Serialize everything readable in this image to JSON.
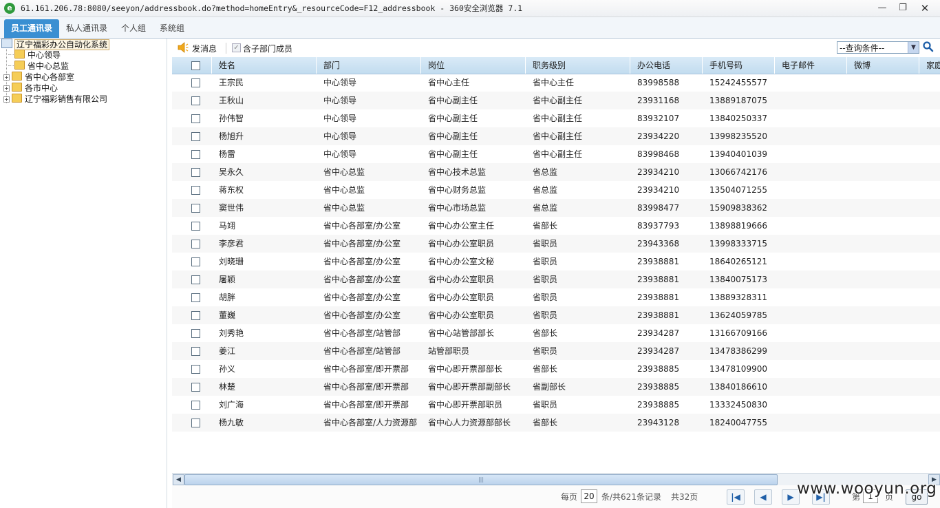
{
  "window": {
    "title": "61.161.206.78:8080/seeyon/addressbook.do?method=homeEntry&_resourceCode=F12_addressbook - 360安全浏览器 7.1"
  },
  "tabs": [
    {
      "label": "员工通讯录",
      "active": true
    },
    {
      "label": "私人通讯录",
      "active": false
    },
    {
      "label": "个人组",
      "active": false
    },
    {
      "label": "系统组",
      "active": false
    }
  ],
  "tree": {
    "root": "辽宁福彩办公自动化系统",
    "items": [
      {
        "label": "中心领导",
        "expandable": false
      },
      {
        "label": "省中心总监",
        "expandable": false
      },
      {
        "label": "省中心各部室",
        "expandable": true
      },
      {
        "label": "各市中心",
        "expandable": true
      },
      {
        "label": "辽宁福彩销售有限公司",
        "expandable": true
      }
    ]
  },
  "toolbar": {
    "send_message": "发消息",
    "include_sub": "含子部门成员",
    "query_placeholder": "--查询条件--"
  },
  "grid": {
    "columns": [
      "姓名",
      "部门",
      "岗位",
      "职务级别",
      "办公电话",
      "手机号码",
      "电子邮件",
      "微博",
      "家庭"
    ],
    "rows": [
      [
        "王宗民",
        "中心领导",
        "省中心主任",
        "省中心主任",
        "83998588",
        "15242455577"
      ],
      [
        "王秋山",
        "中心领导",
        "省中心副主任",
        "省中心副主任",
        "23931168",
        "13889187075"
      ],
      [
        "孙伟智",
        "中心领导",
        "省中心副主任",
        "省中心副主任",
        "83932107",
        "13840250337"
      ],
      [
        "杨旭升",
        "中心领导",
        "省中心副主任",
        "省中心副主任",
        "23934220",
        "13998235520"
      ],
      [
        "杨雷",
        "中心领导",
        "省中心副主任",
        "省中心副主任",
        "83998468",
        "13940401039"
      ],
      [
        "吴永久",
        "省中心总监",
        "省中心技术总监",
        "省总监",
        "23934210",
        "13066742176"
      ],
      [
        "蒋东权",
        "省中心总监",
        "省中心财务总监",
        "省总监",
        "23934210",
        "13504071255"
      ],
      [
        "窦世伟",
        "省中心总监",
        "省中心市场总监",
        "省总监",
        "83998477",
        "15909838362"
      ],
      [
        "马翊",
        "省中心各部室/办公室",
        "省中心办公室主任",
        "省部长",
        "83937793",
        "13898819666"
      ],
      [
        "李彦君",
        "省中心各部室/办公室",
        "省中心办公室职员",
        "省职员",
        "23943368",
        "13998333715"
      ],
      [
        "刘晓珊",
        "省中心各部室/办公室",
        "省中心办公室文秘",
        "省职员",
        "23938881",
        "18640265121"
      ],
      [
        "屠颖",
        "省中心各部室/办公室",
        "省中心办公室职员",
        "省职员",
        "23938881",
        "13840075173"
      ],
      [
        "胡胖",
        "省中心各部室/办公室",
        "省中心办公室职员",
        "省职员",
        "23938881",
        "13889328311"
      ],
      [
        "董巍",
        "省中心各部室/办公室",
        "省中心办公室职员",
        "省职员",
        "23938881",
        "13624059785"
      ],
      [
        "刘秀艳",
        "省中心各部室/站管部",
        "省中心站管部部长",
        "省部长",
        "23934287",
        "13166709166"
      ],
      [
        "姜江",
        "省中心各部室/站管部",
        "站管部职员",
        "省职员",
        "23934287",
        "13478386299"
      ],
      [
        "孙义",
        "省中心各部室/即开票部",
        "省中心即开票部部长",
        "省部长",
        "23938885",
        "13478109900"
      ],
      [
        "林楚",
        "省中心各部室/即开票部",
        "省中心即开票部副部长",
        "省副部长",
        "23938885",
        "13840186610"
      ],
      [
        "刘广海",
        "省中心各部室/即开票部",
        "省中心即开票部职员",
        "省职员",
        "23938885",
        "13332450830"
      ],
      [
        "杨九敏",
        "省中心各部室/人力资源部",
        "省中心人力资源部部长",
        "省部长",
        "23943128",
        "18240047755"
      ]
    ]
  },
  "pager": {
    "per_page_label": "每页",
    "per_page": "20",
    "total_label": "条/共621条记录",
    "pages_label": "共32页",
    "page_prefix": "第",
    "current_page": "1",
    "page_suffix": "页",
    "go_label": "go"
  },
  "watermark": "www.wooyun.org"
}
